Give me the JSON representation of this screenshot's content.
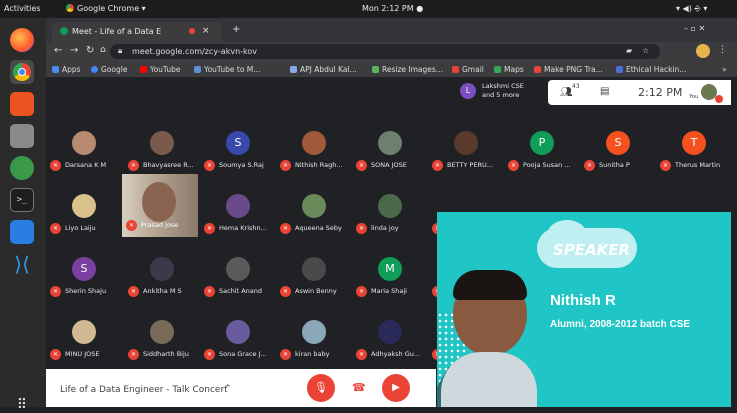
{
  "topbar": {
    "activities": "Activities",
    "app": "Google Chrome ▾",
    "clock": "Mon  2:12 PM ●"
  },
  "chrome": {
    "tab_title": "Meet - Life of a Data E",
    "url": "meet.google.com/zcy-akvn-kov",
    "bookmarks": [
      "Apps",
      "Google",
      "YouTube",
      "YouTube to M...",
      "APJ Abdul Kal...",
      "Resize Images...",
      "Gmail",
      "Maps",
      "Make PNG Tra...",
      "Ethical Hackin..."
    ]
  },
  "meet": {
    "presenter_line1": "Lakshmi CSE",
    "presenter_line2": "and 5 more",
    "participant_count": "43",
    "time": "2:12 PM",
    "you_label": "You",
    "meeting_title": "Life of a Data Engineer - Talk Concert",
    "participants": [
      [
        "Darsana K M",
        "Bhavyasree R...",
        "Soumya S.Raj",
        "Nithish Ragh...",
        "SONA JOSE",
        "BETTY PERU...",
        "Pooja Susan ...",
        "Sunitha P",
        "Therus Martin"
      ],
      [
        "Liyo Laiju",
        "Prasad Jose",
        "Hema Krishn...",
        "Aqueena Seby",
        "linda joy"
      ],
      [
        "Sherin Shaju",
        "Ankitha M S",
        "Sachit Anand",
        "Aswin Benny",
        "Maria Shaji"
      ],
      [
        "MINU JOSE",
        "Siddharth Biju",
        "Sona Grace J...",
        "kiran baby",
        "Adhyaksh Gu..."
      ]
    ],
    "avatar_letters": {
      "soumya": "S",
      "pooja": "P",
      "sunitha": "S",
      "therus": "T",
      "sherin": "S",
      "maria": "M",
      "row2_extra": "S"
    }
  },
  "speaker": {
    "badge": "SPEAKER",
    "name": "Nithish R",
    "subtitle": "Alumni, 2008-2012 batch CSE"
  },
  "colors": {
    "accent_red": "#ea4335",
    "teal": "#20c5c6",
    "meet_bg": "#202124"
  }
}
